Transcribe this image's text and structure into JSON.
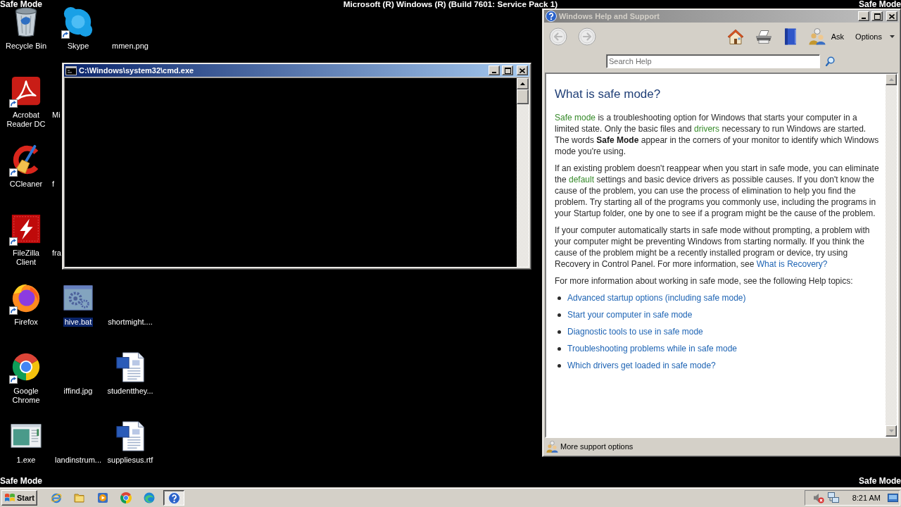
{
  "screen_text": {
    "top_left": "Safe Mode",
    "top_center": "Microsoft (R) Windows (R) (Build 7601: Service Pack 1)",
    "top_right": "Safe Mode",
    "bottom_left": "Safe Mode",
    "bottom_right": "Safe Mode"
  },
  "desktop_icon_rows": [
    {
      "icons": [
        {
          "kind": "icon",
          "label": "Recycle Bin",
          "shortcut": false,
          "selected": false
        },
        {
          "kind": "icon",
          "label": "Skype",
          "shortcut": true,
          "selected": false
        },
        {
          "kind": "icon",
          "label": "mmen.png",
          "shortcut": false,
          "selected": false
        }
      ]
    },
    {
      "icons": [
        {
          "kind": "icon",
          "label": "Acrobat Reader DC",
          "shortcut": true,
          "selected": false
        },
        {
          "kind": "cut",
          "label": "Mi",
          "selected": false
        }
      ]
    },
    {
      "icons": [
        {
          "kind": "icon",
          "label": "CCleaner",
          "shortcut": true,
          "selected": false
        },
        {
          "kind": "cut",
          "label": "f",
          "selected": false
        }
      ]
    },
    {
      "icons": [
        {
          "kind": "icon",
          "label": "FileZilla Client",
          "shortcut": true,
          "selected": false
        },
        {
          "kind": "cut",
          "label": "fra",
          "selected": false
        }
      ]
    },
    {
      "icons": [
        {
          "kind": "icon",
          "label": "Firefox",
          "shortcut": true,
          "selected": false
        },
        {
          "kind": "icon",
          "label": "hive.bat",
          "shortcut": false,
          "selected": true
        },
        {
          "kind": "icon",
          "label": "shortmight....",
          "shortcut": false,
          "selected": false
        }
      ]
    },
    {
      "icons": [
        {
          "kind": "icon",
          "label": "Google Chrome",
          "shortcut": true,
          "selected": false
        },
        {
          "kind": "icon",
          "label": "iffind.jpg",
          "shortcut": false,
          "selected": false
        },
        {
          "kind": "icon",
          "label": "studentthey...",
          "shortcut": false,
          "selected": false
        }
      ]
    },
    {
      "icons": [
        {
          "kind": "icon",
          "label": "1.exe",
          "shortcut": false,
          "selected": false
        },
        {
          "kind": "icon",
          "label": "landinstrum...",
          "shortcut": false,
          "selected": false
        },
        {
          "kind": "icon",
          "label": "suppliesus.rtf",
          "shortcut": false,
          "selected": false
        }
      ]
    }
  ],
  "cmd_window": {
    "title": "C:\\Windows\\system32\\cmd.exe",
    "active": true
  },
  "help_window": {
    "title": "Windows Help and Support",
    "active": false,
    "back": {
      "disabled": true
    },
    "forward": {
      "disabled": true
    },
    "ask": "Ask",
    "options": "Options",
    "search": {
      "placeholder": "Search Help"
    },
    "article": {
      "heading": "What is safe mode?",
      "paragraphs": [
        [
          {
            "kind": "term",
            "text": "Safe mode"
          },
          {
            "kind": "text",
            "text": " is a troubleshooting option for Windows that starts your computer in a limited state. Only the basic files and "
          },
          {
            "kind": "term",
            "text": "drivers"
          },
          {
            "kind": "text",
            "text": " necessary to run Windows are started. The words **Safe Mode** appear in the corners of your monitor to identify which Windows mode you're using."
          }
        ],
        [
          {
            "kind": "text",
            "text": "If an existing problem doesn't reappear when you start in safe mode, you can eliminate the "
          },
          {
            "kind": "term",
            "text": "default"
          },
          {
            "kind": "text",
            "text": " settings and basic device drivers as possible causes. If you don't know the cause of the problem, you can use the process of elimination to help you find the problem. Try starting all of the programs you commonly use, including the programs in your Startup folder, one by one to see if a program might be the cause of the problem."
          }
        ],
        [
          {
            "kind": "text",
            "text": "If your computer automatically starts in safe mode without prompting, a problem with your computer might be preventing Windows from starting normally. If you think the cause of the problem might be a recently installed program or device, try using Recovery in Control Panel. For more information, see "
          },
          {
            "kind": "link",
            "text": "What is Recovery?"
          }
        ],
        [
          {
            "kind": "text",
            "text": "For more information about working in safe mode, see the following Help topics:"
          }
        ]
      ],
      "topics": [
        "Advanced startup options (including safe mode)",
        "Start your computer in safe mode",
        "Diagnostic tools to use in safe mode",
        "Troubleshooting problems while in safe mode",
        "Which drivers get loaded in safe mode?"
      ]
    },
    "footer": "More support options"
  },
  "taskbar": {
    "start": "Start",
    "task_buttons": [
      {
        "pressed": true
      }
    ],
    "clock": "8:21 AM"
  }
}
